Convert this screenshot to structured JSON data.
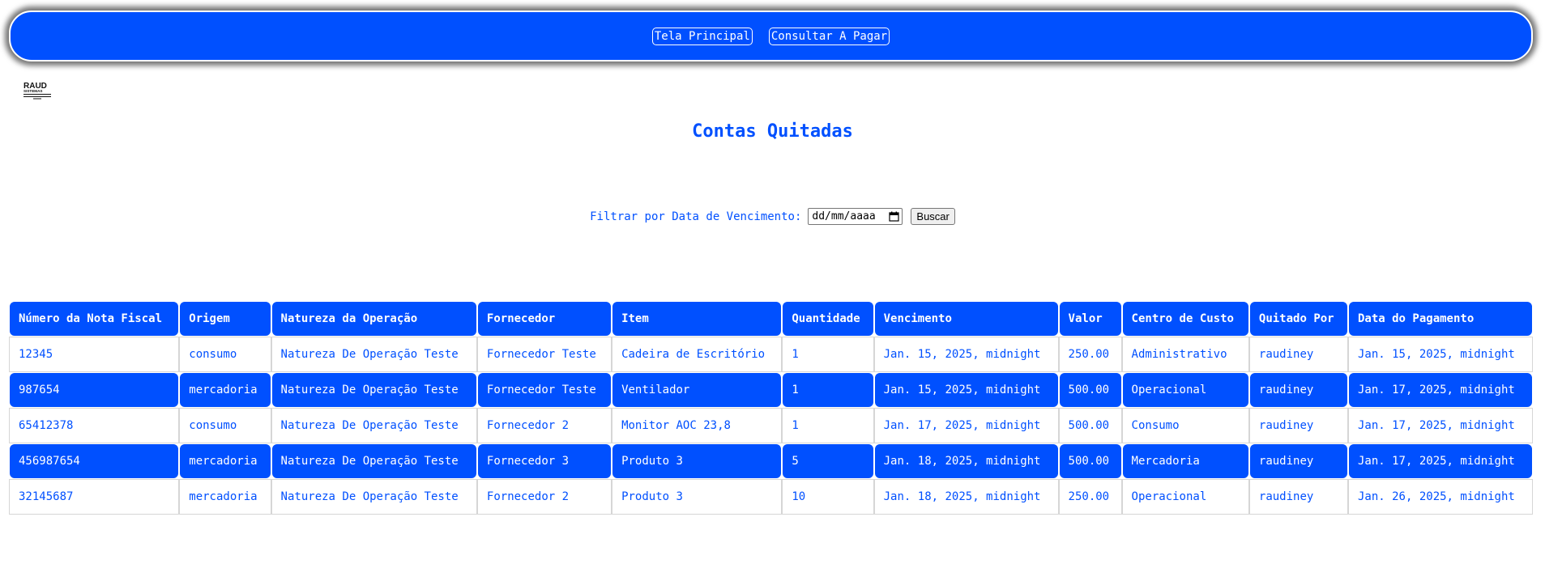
{
  "nav": {
    "main_label": "Tela Principal",
    "payables_label": "Consultar A Pagar"
  },
  "logo": {
    "text_top": "RAUD",
    "text_bottom": "SISTEMAS"
  },
  "page": {
    "title": "Contas Quitadas"
  },
  "filter": {
    "label": "Filtrar por Data de Vencimento:",
    "date_placeholder": "dd/mm/aaaa",
    "search_label": "Buscar"
  },
  "table": {
    "headers": [
      "Número da Nota Fiscal",
      "Origem",
      "Natureza da Operação",
      "Fornecedor",
      "Item",
      "Quantidade",
      "Vencimento",
      "Valor",
      "Centro de Custo",
      "Quitado Por",
      "Data do Pagamento"
    ],
    "rows": [
      [
        "12345",
        "consumo",
        "Natureza De Operação Teste",
        "Fornecedor Teste",
        "Cadeira de Escritório",
        "1",
        "Jan. 15, 2025, midnight",
        "250.00",
        "Administrativo",
        "raudiney",
        "Jan. 15, 2025, midnight"
      ],
      [
        "987654",
        "mercadoria",
        "Natureza De Operação Teste",
        "Fornecedor Teste",
        "Ventilador",
        "1",
        "Jan. 15, 2025, midnight",
        "500.00",
        "Operacional",
        "raudiney",
        "Jan. 17, 2025, midnight"
      ],
      [
        "65412378",
        "consumo",
        "Natureza De Operação Teste",
        "Fornecedor 2",
        "Monitor AOC 23,8",
        "1",
        "Jan. 17, 2025, midnight",
        "500.00",
        "Consumo",
        "raudiney",
        "Jan. 17, 2025, midnight"
      ],
      [
        "456987654",
        "mercadoria",
        "Natureza De Operação Teste",
        "Fornecedor 3",
        "Produto 3",
        "5",
        "Jan. 18, 2025, midnight",
        "500.00",
        "Mercadoria",
        "raudiney",
        "Jan. 17, 2025, midnight"
      ],
      [
        "32145687",
        "mercadoria",
        "Natureza De Operação Teste",
        "Fornecedor 2",
        "Produto 3",
        "10",
        "Jan. 18, 2025, midnight",
        "250.00",
        "Operacional",
        "raudiney",
        "Jan. 26, 2025, midnight"
      ]
    ]
  },
  "colors": {
    "primary": "#0050ff",
    "on_primary": "#ffffff"
  }
}
